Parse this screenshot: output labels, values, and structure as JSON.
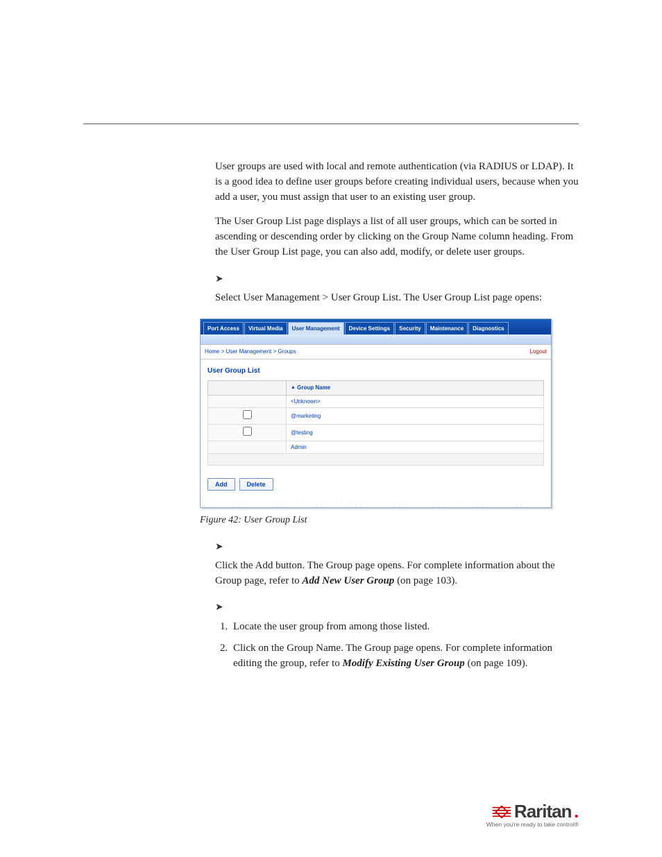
{
  "paragraphs": {
    "p1": "User groups are used with local and remote authentication (via RADIUS or LDAP). It is a good idea to define user groups before creating individual users, because when you add a user, you must assign that user to an existing user group.",
    "p2": "The User Group List page displays a list of all user groups, which can be sorted in ascending or descending order by clicking on the Group Name column heading. From the User Group List page, you can also add, modify, or delete user groups.",
    "p3": "Select User Management > User Group List. The User Group List page opens:",
    "add_pre": "Click the Add button. The Group page opens. For complete information about the Group page, refer to ",
    "add_link": "Add New User Group",
    "add_post": " (on page 103).",
    "mod1": "Locate the user group from among those listed.",
    "mod2_pre": "Click on the Group Name. The Group page opens. For complete information editing the group, refer to ",
    "mod2_link": "Modify Existing User Group",
    "mod2_post": " (on page 109)."
  },
  "screenshot": {
    "tabs": [
      "Port Access",
      "Virtual Media",
      "User Management",
      "Device Settings",
      "Security",
      "Maintenance",
      "Diagnostics"
    ],
    "active_tab_index": 2,
    "breadcrumb": "Home > User Management > Groups",
    "logout": "Logout",
    "panel_title": "User Group List",
    "column_header": "Group Name",
    "sort_indicator": "▲",
    "rows": [
      {
        "checkbox": false,
        "name": "<Unknown>"
      },
      {
        "checkbox": true,
        "name": "@marketing"
      },
      {
        "checkbox": true,
        "name": "@testing"
      },
      {
        "checkbox": false,
        "name": "Admin"
      }
    ],
    "buttons": {
      "add": "Add",
      "delete": "Delete"
    }
  },
  "caption": "Figure 42: User Group List",
  "footer": {
    "brand": "Raritan",
    "tagline": "When you're ready to take control®"
  }
}
